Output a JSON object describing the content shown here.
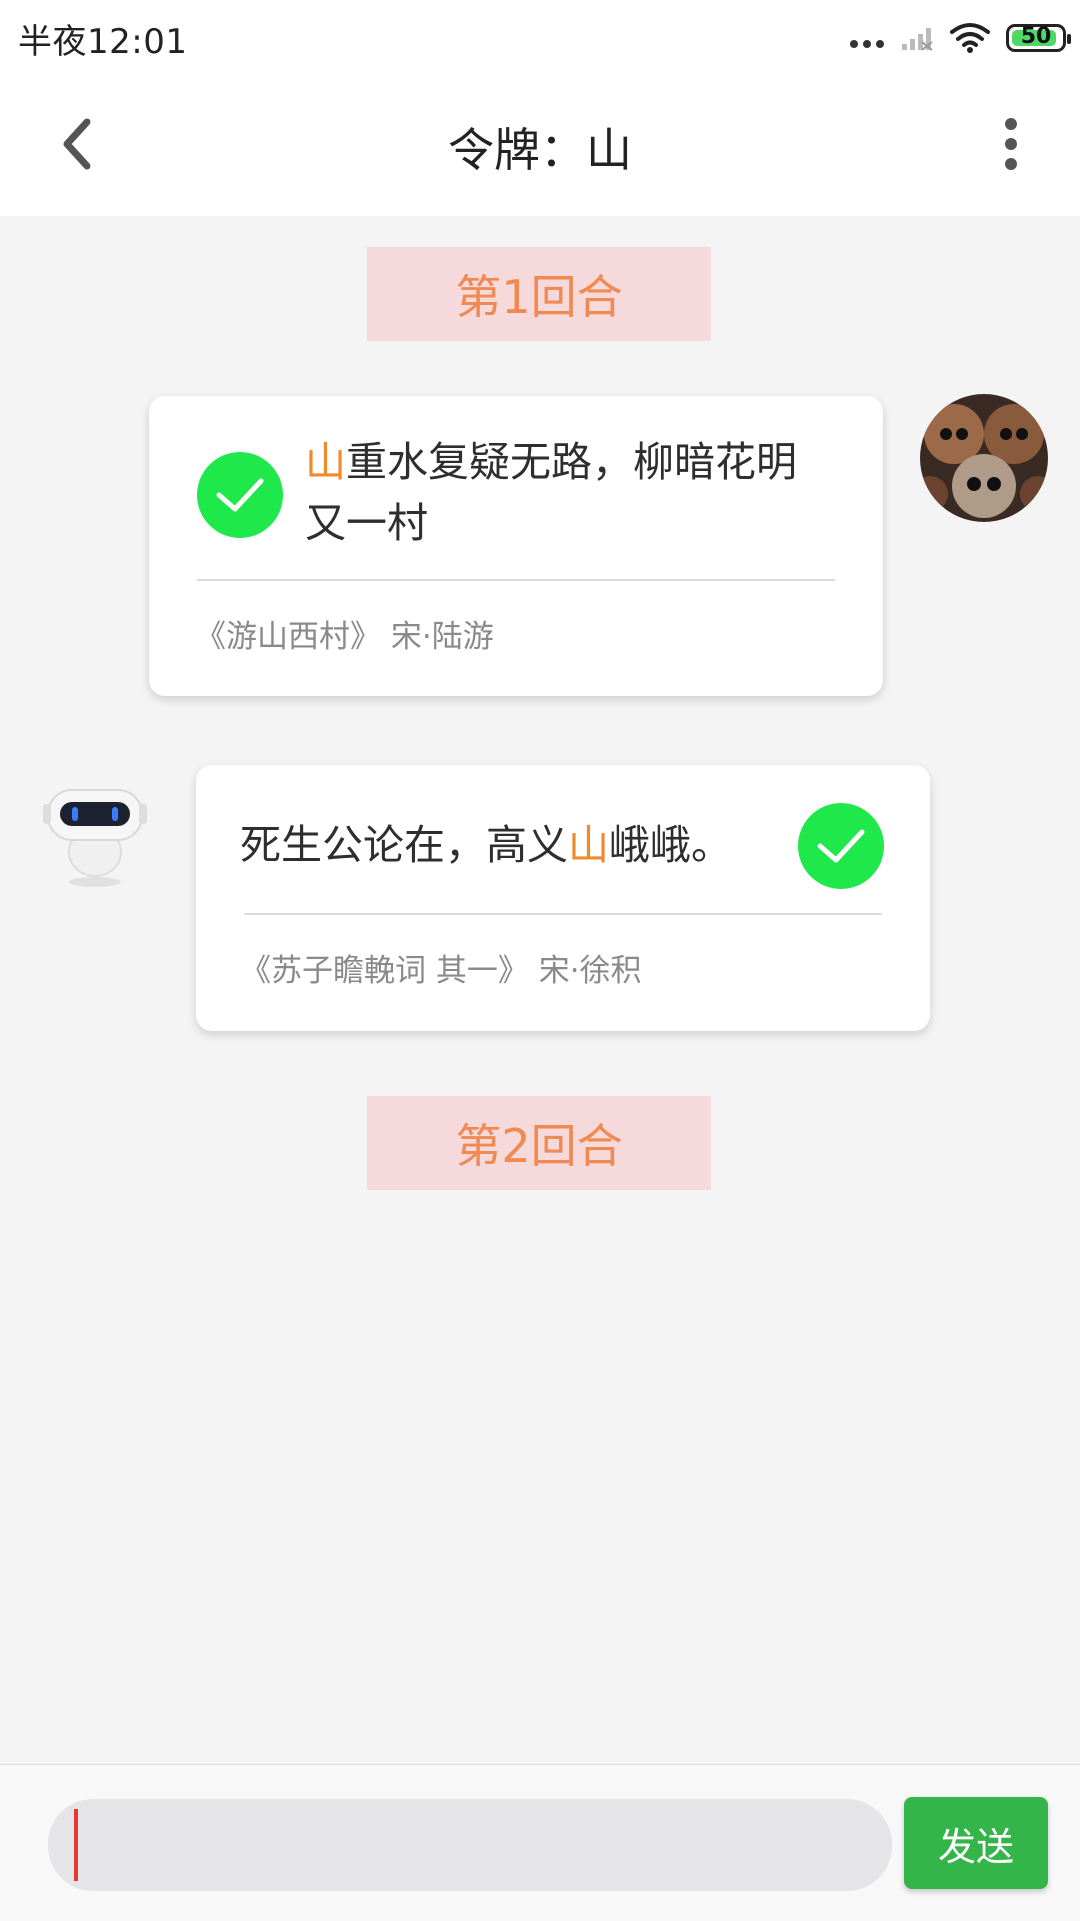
{
  "status_bar": {
    "time": "半夜12:01",
    "battery_percent": "50",
    "icons": [
      "more-dots-icon",
      "signal-icon",
      "wifi-icon",
      "battery-icon"
    ]
  },
  "header": {
    "title": "令牌：山",
    "back_icon": "chevron-left-icon",
    "more_icon": "more-vertical-icon"
  },
  "chat": {
    "rounds": [
      {
        "label": "第1回合"
      },
      {
        "label": "第2回合"
      }
    ],
    "messages": [
      {
        "sender": "user",
        "verse_highlight": "山",
        "verse_rest": "重水复疑无路，柳暗花明又一村",
        "source": "《游山西村》 宋·陆游",
        "status_icon": "check-icon"
      },
      {
        "sender": "bot",
        "verse_before": "死生公论在，高义",
        "verse_highlight": "山",
        "verse_after": "峨峨。",
        "source": "《苏子瞻輓词 其一》 宋·徐积",
        "status_icon": "check-icon"
      }
    ]
  },
  "input": {
    "placeholder": "",
    "value": "",
    "send_label": "发送"
  },
  "colors": {
    "highlight": "#f08a2c",
    "round_bg": "#f6d9da",
    "round_text": "#f08a52",
    "check": "#1ee84a",
    "send_button": "#34b54a"
  }
}
